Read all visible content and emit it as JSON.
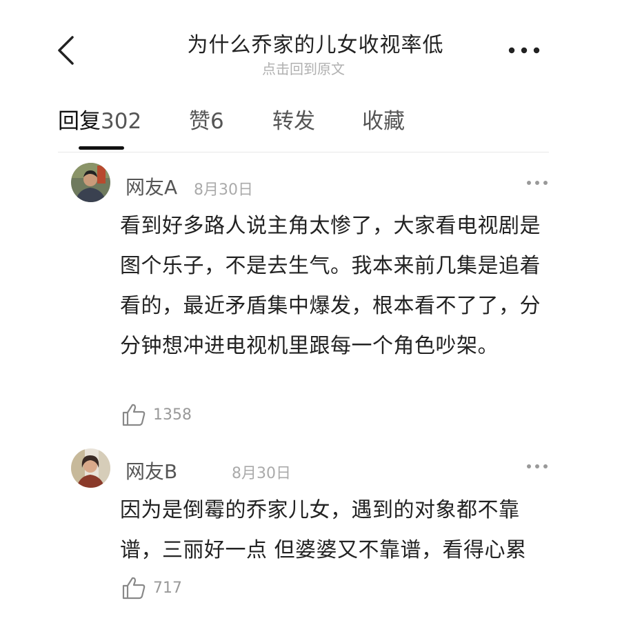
{
  "header": {
    "title": "为什么乔家的儿女收视率低",
    "subtitle": "点击回到原文",
    "back_icon": "chevron-left-icon",
    "more_icon": "more-dots-icon"
  },
  "tabs": [
    {
      "label": "回复",
      "count": "302",
      "active": true
    },
    {
      "label": "赞",
      "count": "6",
      "active": false
    },
    {
      "label": "转发",
      "count": "",
      "active": false
    },
    {
      "label": "收藏",
      "count": "",
      "active": false
    }
  ],
  "comments": [
    {
      "username": "网友A",
      "date": "8月30日",
      "text": "看到好多路人说主角太惨了，大家看电视剧是图个乐子，不是去生气。我本来前几集是追着看的，最近矛盾集中爆发，根本看不了了，分分钟想冲进电视机里跟每一个角色吵架。",
      "likes": "1358"
    },
    {
      "username": "网友B",
      "date": "8月30日",
      "text": "因为是倒霉的乔家儿女，遇到的对象都不靠谱，三丽好一点 但婆婆又不靠谱，看得心累",
      "likes": "717"
    }
  ],
  "colors": {
    "text_primary": "#222222",
    "text_muted": "#aaaaaa",
    "tab_indicator": "#111111",
    "divider": "#e8e8e8"
  }
}
